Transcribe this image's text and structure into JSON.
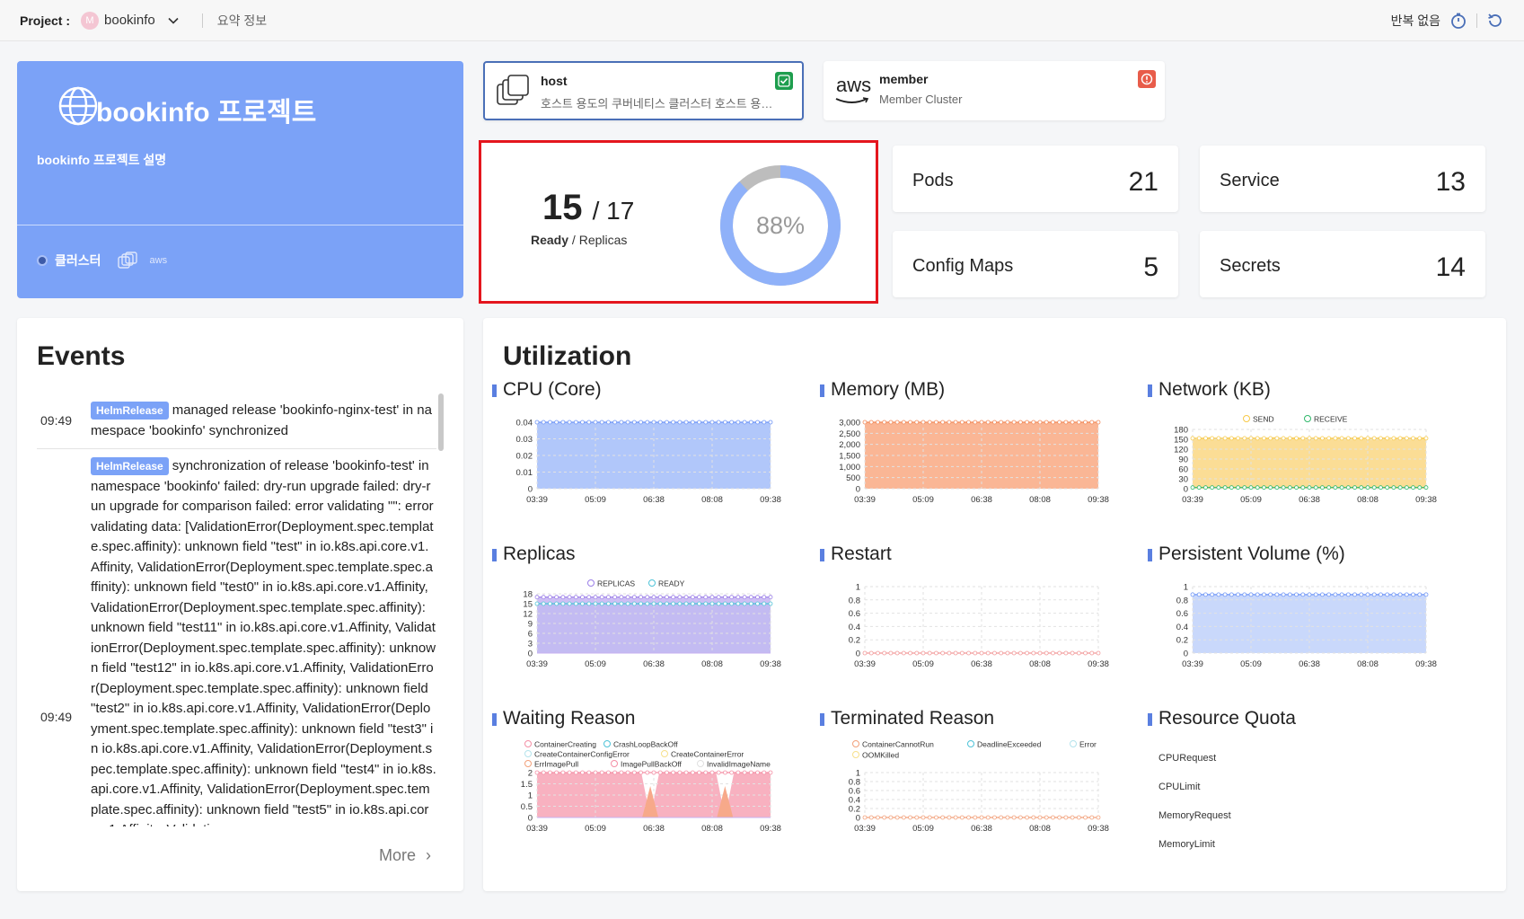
{
  "topbar": {
    "project_label": "Project :",
    "avatar_letter": "M",
    "project_name": "bookinfo",
    "subtitle": "요약 정보",
    "refresh_label": "반복 없음"
  },
  "project_card": {
    "title": "bookinfo 프로젝트",
    "description": "bookinfo 프로젝트 설명",
    "cluster_label": "클러스터",
    "aws_label": "aws"
  },
  "clusters": [
    {
      "name": "host",
      "description": "호스트 용도의 쿠버네티스 클러스터 호스트 용도의 쿠버네티스",
      "status": "ok",
      "color": "#1e9e4e"
    },
    {
      "name": "member",
      "description": "Member Cluster",
      "logo": "aws",
      "status": "error",
      "color": "#e85c4a"
    }
  ],
  "ready": {
    "ready": "15",
    "total": "/ 17",
    "ready_label": "Ready",
    "sep": "/",
    "replicas_label": "Replicas",
    "percent": "88%",
    "fraction": 0.88
  },
  "stats": [
    {
      "label": "Pods",
      "value": "21"
    },
    {
      "label": "Service",
      "value": "13"
    },
    {
      "label": "Config Maps",
      "value": "5"
    },
    {
      "label": "Secrets",
      "value": "14"
    }
  ],
  "events": {
    "title": "Events",
    "more": "More",
    "items": [
      {
        "time": "09:49",
        "tag": "HelmRelease",
        "text": "managed release 'bookinfo-nginx-test' in namespace 'bookinfo' synchronized"
      },
      {
        "time": "09:49",
        "tag": "HelmRelease",
        "text": "synchronization of release 'bookinfo-test' in namespace 'bookinfo' failed: dry-run upgrade failed: dry-run upgrade for comparison failed: error validating \"\": error validating data: [ValidationError(Deployment.spec.template.spec.affinity): unknown field \"test\" in io.k8s.api.core.v1.Affinity, ValidationError(Deployment.spec.template.spec.affinity): unknown field \"test0\" in io.k8s.api.core.v1.Affinity, ValidationError(Deployment.spec.template.spec.affinity): unknown field \"test11\" in io.k8s.api.core.v1.Affinity, ValidationError(Deployment.spec.template.spec.affinity): unknown field \"test12\" in io.k8s.api.core.v1.Affinity, ValidationError(Deployment.spec.template.spec.affinity): unknown field \"test2\" in io.k8s.api.core.v1.Affinity, ValidationError(Deployment.spec.template.spec.affinity): unknown field \"test3\" in io.k8s.api.core.v1.Affinity, ValidationError(Deployment.spec.template.spec.affinity): unknown field \"test4\" in io.k8s.api.core.v1.Affinity, ValidationError(Deployment.spec.template.spec.affinity): unknown field \"test5\" in io.k8s.api.core.v1.Affinity, Validatio"
      }
    ]
  },
  "utilization": {
    "title": "Utilization",
    "x_ticks": [
      "03:39",
      "05:09",
      "06:38",
      "08:08",
      "09:38"
    ],
    "charts": [
      {
        "title": "CPU (Core)",
        "yticks": [
          "0.04",
          "0.03",
          "0.02",
          "0.01",
          "0"
        ],
        "series": [
          {
            "name": "",
            "color": "#6e95f6",
            "fill": "#a9c1fa",
            "level": 1.0
          }
        ],
        "legend": []
      },
      {
        "title": "Memory (MB)",
        "yticks": [
          "3,000",
          "2,500",
          "2,000",
          "1,500",
          "1,000",
          "500",
          "0"
        ],
        "series": [
          {
            "name": "",
            "color": "#f28a5a",
            "fill": "#f9ae8a",
            "level": 1.0
          }
        ],
        "legend": []
      },
      {
        "title": "Network (KB)",
        "yticks": [
          "180",
          "150",
          "120",
          "90",
          "60",
          "30",
          "0"
        ],
        "series": [
          {
            "name": "SEND",
            "color": "#f7c948",
            "fill": "#fbd98a",
            "level": 0.85
          },
          {
            "name": "RECEIVE",
            "color": "#31b86b",
            "fill": "#9ee3b8",
            "level": 0.02
          }
        ],
        "legend": [
          "SEND",
          "RECEIVE"
        ]
      },
      {
        "title": "Replicas",
        "yticks": [
          "18",
          "15",
          "12",
          "9",
          "6",
          "3",
          "0"
        ],
        "series": [
          {
            "name": "REPLICAS",
            "color": "#9b7fe8",
            "fill": "#c9b8f3",
            "level": 0.944
          },
          {
            "name": "READY",
            "color": "#4ec3d8",
            "fill": "#7dcfe0",
            "level": 0.833
          }
        ],
        "legend": [
          "REPLICAS",
          "READY"
        ]
      },
      {
        "title": "Restart",
        "yticks": [
          "1",
          "0.8",
          "0.6",
          "0.4",
          "0.2",
          "0"
        ],
        "series": [
          {
            "name": "",
            "color": "#f29a9a",
            "fill": "none",
            "level": 0
          }
        ],
        "legend": []
      },
      {
        "title": "Persistent Volume (%)",
        "yticks": [
          "1",
          "0.8",
          "0.6",
          "0.4",
          "0.2",
          "0"
        ],
        "series": [
          {
            "name": "",
            "color": "#6e95f6",
            "fill": "#c3d4fb",
            "level": 0.88
          }
        ],
        "legend": []
      },
      {
        "title": "Waiting Reason",
        "yticks": [
          "2",
          "1.5",
          "1",
          "0.5",
          "0"
        ],
        "series": [
          {
            "name": "ErrImagePull",
            "color": "#f48fa5",
            "fill": "#f7a8b9",
            "level": 1.0
          }
        ],
        "legend": [
          "ContainerCreating",
          "CrashLoopBackOff",
          "CreateContainerConfigError",
          "CreateContainerError",
          "ErrImagePull",
          "ImagePullBackOff",
          "InvalidImageName"
        ]
      },
      {
        "title": "Terminated Reason",
        "yticks": [
          "1",
          "0.8",
          "0.6",
          "0.4",
          "0.2",
          "0"
        ],
        "series": [
          {
            "name": "",
            "color": "#f2a07a",
            "fill": "none",
            "level": 0
          }
        ],
        "legend": [
          "ContainerCannotRun",
          "DeadlineExceeded",
          "Error",
          "OOMKilled"
        ]
      },
      {
        "title": "Resource Quota",
        "items": [
          "CPURequest",
          "CPULimit",
          "MemoryRequest",
          "MemoryLimit"
        ]
      }
    ]
  }
}
